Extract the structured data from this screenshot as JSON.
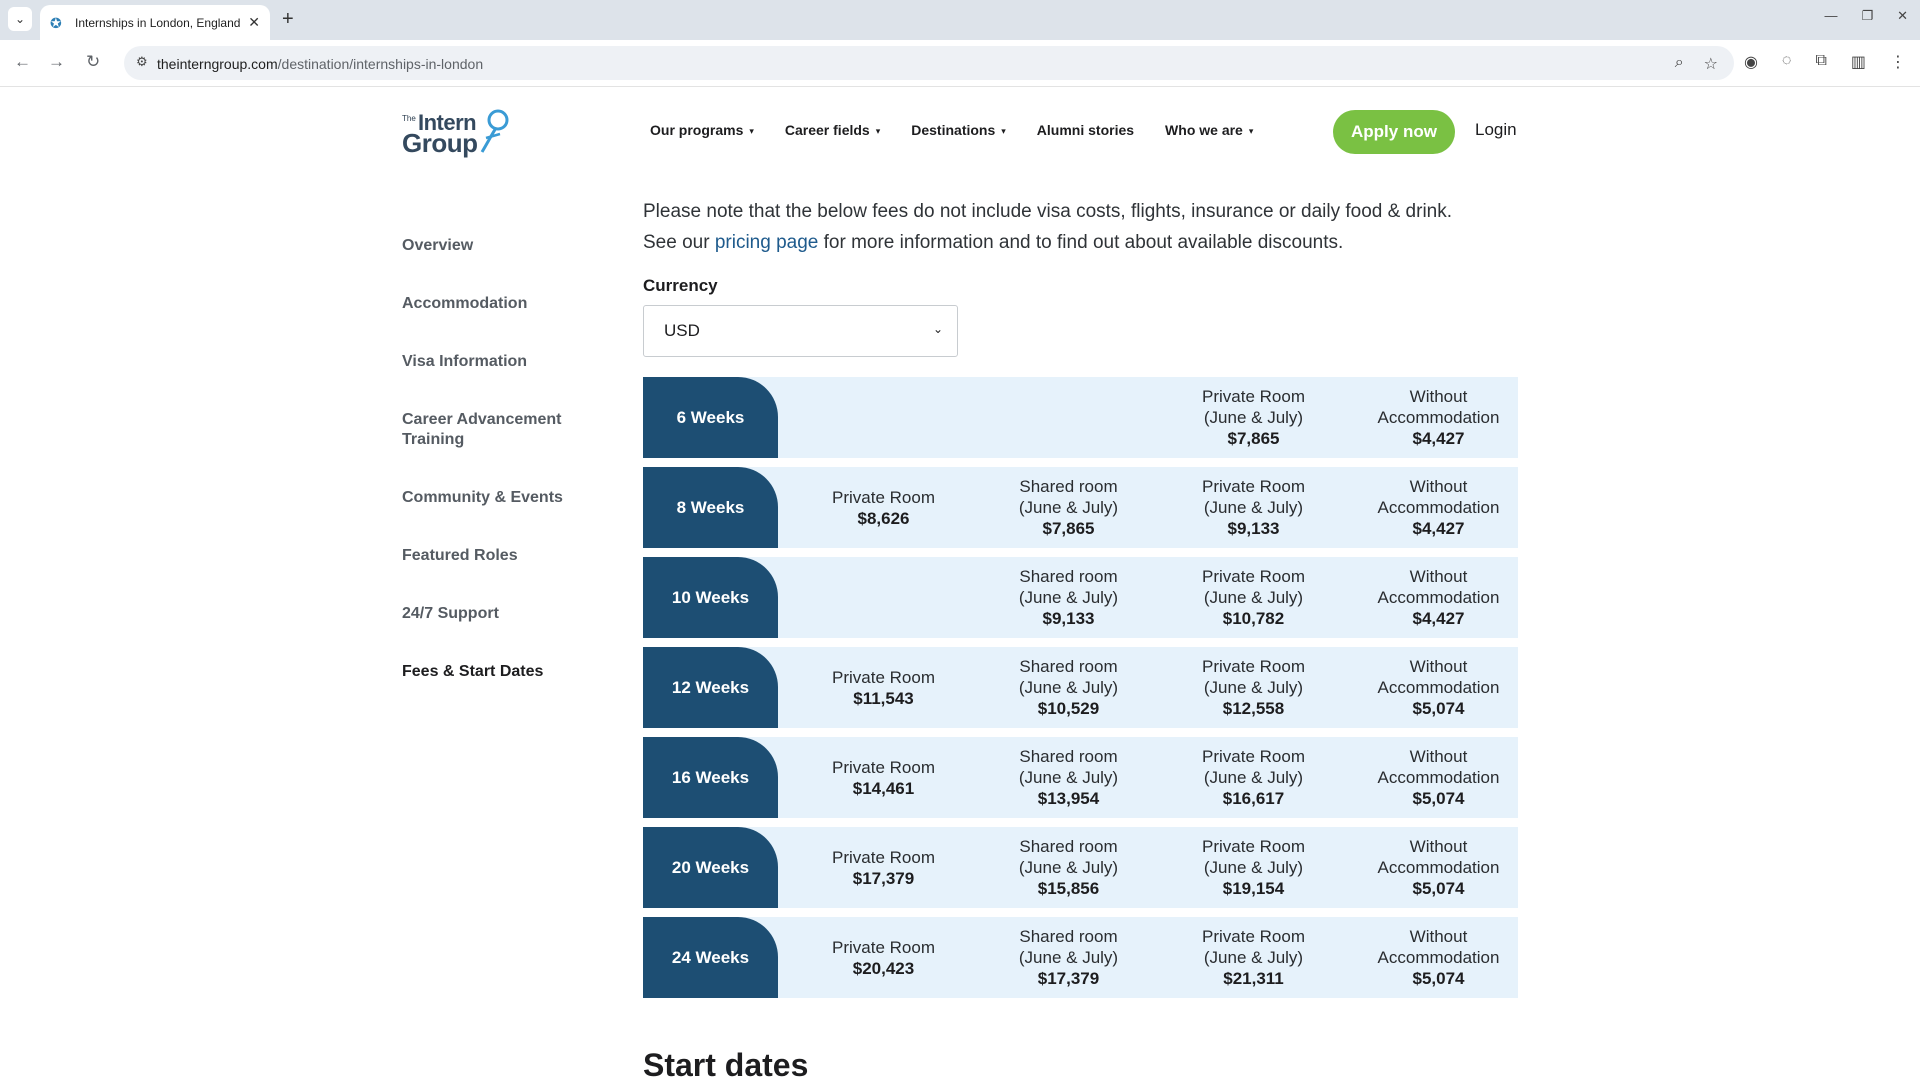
{
  "browser": {
    "tab_title": "Internships in London, England",
    "url_host": "theinterngroup.com",
    "url_path": "/destination/internships-in-london"
  },
  "header": {
    "logo_the": "The",
    "logo_intern": "Intern",
    "logo_group": "Group",
    "nav": [
      {
        "label": "Our programs",
        "dropdown": true
      },
      {
        "label": "Career fields",
        "dropdown": true
      },
      {
        "label": "Destinations",
        "dropdown": true
      },
      {
        "label": "Alumni stories",
        "dropdown": false
      },
      {
        "label": "Who we are",
        "dropdown": true
      }
    ],
    "apply_label": "Apply now",
    "login_label": "Login"
  },
  "sidebar": {
    "items": [
      {
        "label": "Overview"
      },
      {
        "label": "Accommodation"
      },
      {
        "label": "Visa Information"
      },
      {
        "label": "Career Advancement Training"
      },
      {
        "label": "Community & Events"
      },
      {
        "label": "Featured Roles"
      },
      {
        "label": "24/7 Support"
      },
      {
        "label": "Fees & Start Dates"
      }
    ],
    "active": "Fees & Start Dates"
  },
  "main": {
    "note_line1": "Please note that the below fees do not include visa costs, flights, insurance or daily food & drink.",
    "note_pre": "See our ",
    "note_link": "pricing page",
    "note_post": " for more information and to find out about available discounts.",
    "currency_label": "Currency",
    "currency_value": "USD",
    "start_dates_heading": "Start dates"
  },
  "fees": [
    {
      "duration": "6 Weeks",
      "cells": [
        null,
        null,
        {
          "line1": "Private Room",
          "line2": "(June & July)",
          "price": "$7,865"
        },
        {
          "line1": "Without",
          "line2": "Accommodation",
          "price": "$4,427"
        }
      ]
    },
    {
      "duration": "8 Weeks",
      "cells": [
        {
          "line1": "Private Room",
          "price": "$8,626"
        },
        {
          "line1": "Shared room",
          "line2": "(June & July)",
          "price": "$7,865"
        },
        {
          "line1": "Private Room",
          "line2": "(June & July)",
          "price": "$9,133"
        },
        {
          "line1": "Without",
          "line2": "Accommodation",
          "price": "$4,427"
        }
      ]
    },
    {
      "duration": "10 Weeks",
      "cells": [
        null,
        {
          "line1": "Shared room",
          "line2": "(June & July)",
          "price": "$9,133"
        },
        {
          "line1": "Private Room",
          "line2": "(June & July)",
          "price": "$10,782"
        },
        {
          "line1": "Without",
          "line2": "Accommodation",
          "price": "$4,427"
        }
      ]
    },
    {
      "duration": "12 Weeks",
      "cells": [
        {
          "line1": "Private Room",
          "price": "$11,543"
        },
        {
          "line1": "Shared room",
          "line2": "(June & July)",
          "price": "$10,529"
        },
        {
          "line1": "Private Room",
          "line2": "(June & July)",
          "price": "$12,558"
        },
        {
          "line1": "Without",
          "line2": "Accommodation",
          "price": "$5,074"
        }
      ]
    },
    {
      "duration": "16 Weeks",
      "cells": [
        {
          "line1": "Private Room",
          "price": "$14,461"
        },
        {
          "line1": "Shared room",
          "line2": "(June & July)",
          "price": "$13,954"
        },
        {
          "line1": "Private Room",
          "line2": "(June & July)",
          "price": "$16,617"
        },
        {
          "line1": "Without",
          "line2": "Accommodation",
          "price": "$5,074"
        }
      ]
    },
    {
      "duration": "20 Weeks",
      "cells": [
        {
          "line1": "Private Room",
          "price": "$17,379"
        },
        {
          "line1": "Shared room",
          "line2": "(June & July)",
          "price": "$15,856"
        },
        {
          "line1": "Private Room",
          "line2": "(June & July)",
          "price": "$19,154"
        },
        {
          "line1": "Without",
          "line2": "Accommodation",
          "price": "$5,074"
        }
      ]
    },
    {
      "duration": "24 Weeks",
      "cells": [
        {
          "line1": "Private Room",
          "price": "$20,423"
        },
        {
          "line1": "Shared room",
          "line2": "(June & July)",
          "price": "$17,379"
        },
        {
          "line1": "Private Room",
          "line2": "(June & July)",
          "price": "$21,311"
        },
        {
          "line1": "Without",
          "line2": "Accommodation",
          "price": "$5,074"
        }
      ]
    }
  ],
  "colors": {
    "brand_navy": "#1d4e73",
    "row_bg": "#e6f2fb",
    "apply_green": "#7ac143",
    "link_blue": "#1e5a8c"
  }
}
